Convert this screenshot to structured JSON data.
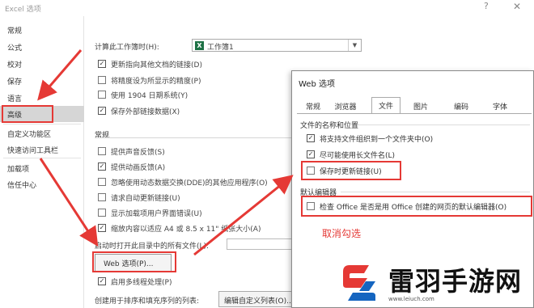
{
  "window": {
    "title": "Excel 选项",
    "help": "?",
    "close": "✕"
  },
  "sidebar": {
    "items": [
      {
        "label": "常规"
      },
      {
        "label": "公式"
      },
      {
        "label": "校对"
      },
      {
        "label": "保存"
      },
      {
        "label": "语言"
      },
      {
        "label": "高级"
      },
      {
        "label": "自定义功能区"
      },
      {
        "label": "快速访问工具栏"
      },
      {
        "label": "加载项"
      },
      {
        "label": "信任中心"
      }
    ],
    "active_index": 5
  },
  "main": {
    "calc_label": "计算此工作簿时(H):",
    "calc_workbook": "工作簿1",
    "options_calc": [
      {
        "label": "更新指向其他文档的链接(D)",
        "checked": true
      },
      {
        "label": "将精度设为所显示的精度(P)",
        "checked": false
      },
      {
        "label": "使用 1904 日期系统(Y)",
        "checked": false
      },
      {
        "label": "保存外部链接数据(X)",
        "checked": true
      }
    ],
    "general_title": "常规",
    "options_general": [
      {
        "label": "提供声音反馈(S)",
        "checked": false
      },
      {
        "label": "提供动画反馈(A)",
        "checked": true
      },
      {
        "label": "忽略使用动态数据交换(DDE)的其他应用程序(O)",
        "checked": false
      },
      {
        "label": "请求自动更新链接(U)",
        "checked": false
      },
      {
        "label": "显示加载项用户界面错误(U)",
        "checked": false
      },
      {
        "label": "缩放内容以适应 A4 或 8.5 x 11\" 纸张大小(A)",
        "checked": true
      }
    ],
    "startup_label": "启动时打开此目录中的所有文件(L):",
    "web_options_button": "Web 选项(P)...",
    "multithread": {
      "label": "启用多线程处理(P)",
      "checked": true
    },
    "sort_label": "创建用于排序和填充序列的列表:",
    "edit_list_button": "编辑自定义列表(O)..."
  },
  "dialog": {
    "title": "Web 选项",
    "tabs": [
      "常规",
      "浏览器",
      "文件",
      "图片",
      "编码",
      "字体"
    ],
    "active_tab": 2,
    "files_group": "文件的名称和位置",
    "files_options": [
      {
        "label": "将支持文件组织到一个文件夹中(O)",
        "checked": true
      },
      {
        "label": "尽可能使用长文件名(L)",
        "checked": true
      },
      {
        "label": "保存时更新链接(U)",
        "checked": false
      }
    ],
    "editor_group": "默认编辑器",
    "editor_option": {
      "label": "检查 Office 是否是用 Office 创建的网页的默认编辑器(O)",
      "checked": false
    }
  },
  "annotation": {
    "text": "取消勾选"
  },
  "watermark": {
    "name": "雷羽手游网",
    "url": "www.leiuch.com"
  },
  "colors": {
    "accent_red": "#e53935",
    "sidebar_active": "#d6d6d6",
    "excel_green": "#1e7145"
  }
}
